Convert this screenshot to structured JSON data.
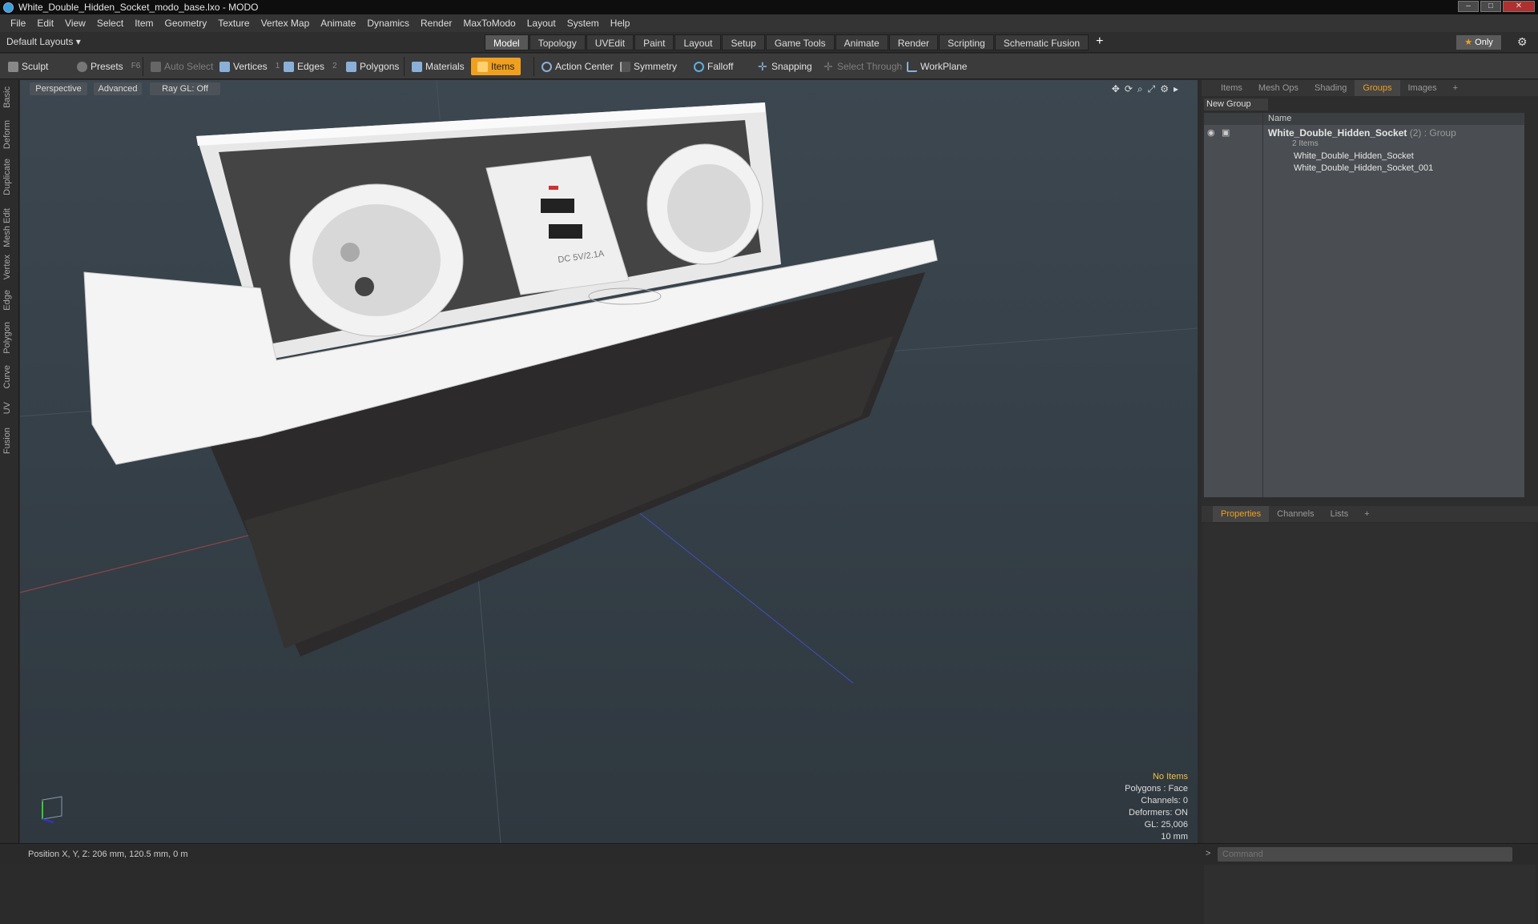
{
  "window": {
    "title": "White_Double_Hidden_Socket_modo_base.lxo - MODO"
  },
  "menu": [
    "File",
    "Edit",
    "View",
    "Select",
    "Item",
    "Geometry",
    "Texture",
    "Vertex Map",
    "Animate",
    "Dynamics",
    "Render",
    "MaxToModo",
    "Layout",
    "System",
    "Help"
  ],
  "layout": {
    "default_layouts": "Default Layouts ▾",
    "tabs": [
      "Model",
      "Topology",
      "UVEdit",
      "Paint",
      "Layout",
      "Setup",
      "Game Tools",
      "Animate",
      "Render",
      "Scripting",
      "Schematic Fusion"
    ],
    "active_tab": "Model",
    "only_label": "Only"
  },
  "toolbar": {
    "sculpt": "Sculpt",
    "presets": "Presets",
    "presets_key": "F6",
    "auto_select": "Auto Select",
    "vertices": "Vertices",
    "vertices_num": "1",
    "edges": "Edges",
    "edges_num": "2",
    "polygons": "Polygons",
    "materials": "Materials",
    "items": "Items",
    "action_center": "Action Center",
    "symmetry": "Symmetry",
    "falloff": "Falloff",
    "snapping": "Snapping",
    "select_through": "Select Through",
    "workplane": "WorkPlane"
  },
  "left_tabs": [
    "Basic",
    "Deform",
    "Duplicate",
    "Mesh Edit",
    "Vertex",
    "Edge",
    "Polygon",
    "Curve",
    "UV",
    "Fusion"
  ],
  "viewport": {
    "perspective": "Perspective",
    "advanced": "Advanced",
    "raygl": "Ray GL: Off",
    "info": {
      "no_items": "No Items",
      "polygons": "Polygons : Face",
      "channels": "Channels: 0",
      "deformers": "Deformers: ON",
      "gl": "GL: 25,006",
      "scale": "10 mm"
    },
    "usb_label": "DC 5V/2.1A"
  },
  "right_panel": {
    "tabs": [
      "Items",
      "Mesh Ops",
      "Shading",
      "Groups",
      "Images"
    ],
    "active_tab": "Groups",
    "new_group": "New Group",
    "name_header": "Name",
    "group_name": "White_Double_Hidden_Socket",
    "group_suffix": "(2) : Group",
    "group_count": "2 Items",
    "items": [
      "White_Double_Hidden_Socket",
      "White_Double_Hidden_Socket_001"
    ],
    "prop_tabs": [
      "Properties",
      "Channels",
      "Lists"
    ],
    "prop_active": "Properties"
  },
  "status": {
    "position": "Position X, Y, Z:  206 mm, 120.5 mm, 0 m",
    "command_placeholder": "Command"
  },
  "colors": {
    "accent": "#f0a020",
    "viewport_bg": "#36414a"
  }
}
